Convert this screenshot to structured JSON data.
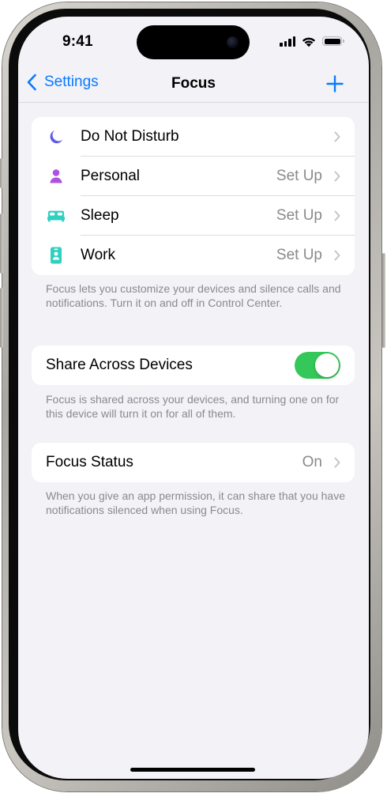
{
  "status_bar": {
    "time": "9:41",
    "icons": [
      "cellular-signal-icon",
      "wifi-icon",
      "battery-icon"
    ],
    "battery_level": 1.0
  },
  "navbar": {
    "back_label": "Settings",
    "title": "Focus",
    "add_icon": "plus-icon"
  },
  "focus_modes": [
    {
      "label": "Do Not Disturb",
      "value": "",
      "icon": "moon-icon",
      "color": "#5e5ce6"
    },
    {
      "label": "Personal",
      "value": "Set Up",
      "icon": "person-icon",
      "color": "#af52de"
    },
    {
      "label": "Sleep",
      "value": "Set Up",
      "icon": "bed-icon",
      "color": "#30d0c0"
    },
    {
      "label": "Work",
      "value": "Set Up",
      "icon": "id-badge-icon",
      "color": "#30d0c0"
    }
  ],
  "focus_footnote": "Focus lets you customize your devices and silence calls and notifications. Turn it on and off in Control Center.",
  "share": {
    "label": "Share Across Devices",
    "enabled": true,
    "footnote": "Focus is shared across your devices, and turning one on for this device will turn it on for all of them."
  },
  "focus_status": {
    "label": "Focus Status",
    "value": "On",
    "footnote": "When you give an app permission, it can share that you have notifications silenced when using Focus."
  },
  "colors": {
    "accent": "#0a7aff",
    "toggle_on": "#34c759",
    "background": "#f2f2f7"
  }
}
